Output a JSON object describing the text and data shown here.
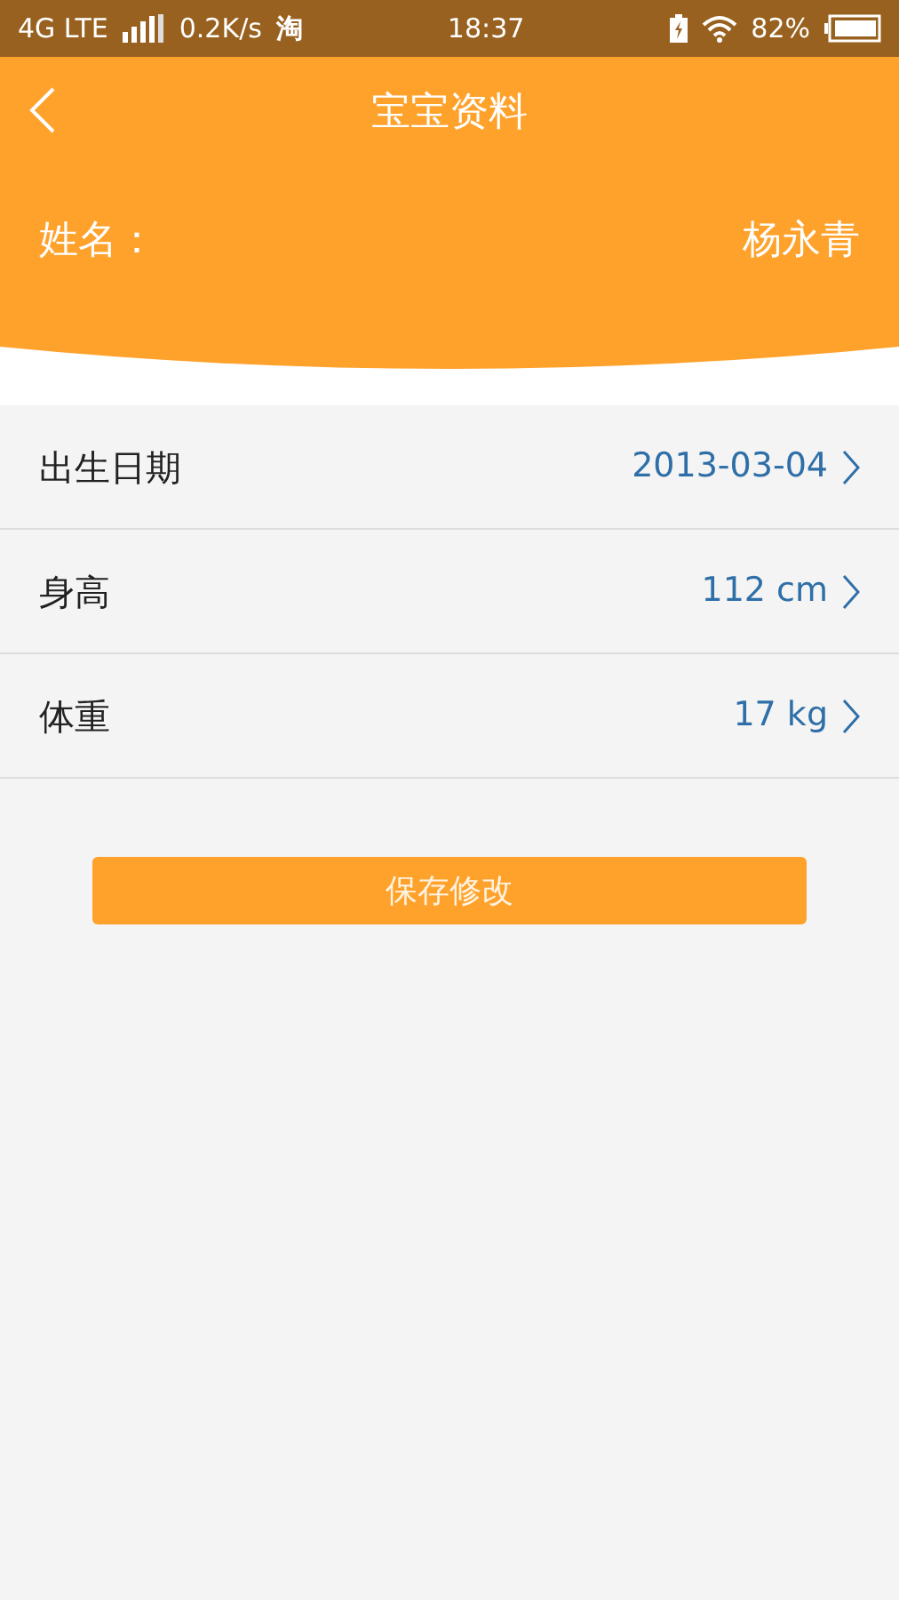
{
  "status_bar": {
    "network": "4G LTE",
    "speed": "0.2K/s",
    "app_glyph": "淘",
    "time": "18:37",
    "battery": "82%"
  },
  "header": {
    "title": "宝宝资料",
    "name_label": "姓名：",
    "name_value": "杨永青"
  },
  "fields": [
    {
      "label": "出生日期",
      "value": "2013-03-04"
    },
    {
      "label": "身高",
      "value": "112 cm"
    },
    {
      "label": "体重",
      "value": "17 kg"
    }
  ],
  "save_button": "保存修改"
}
